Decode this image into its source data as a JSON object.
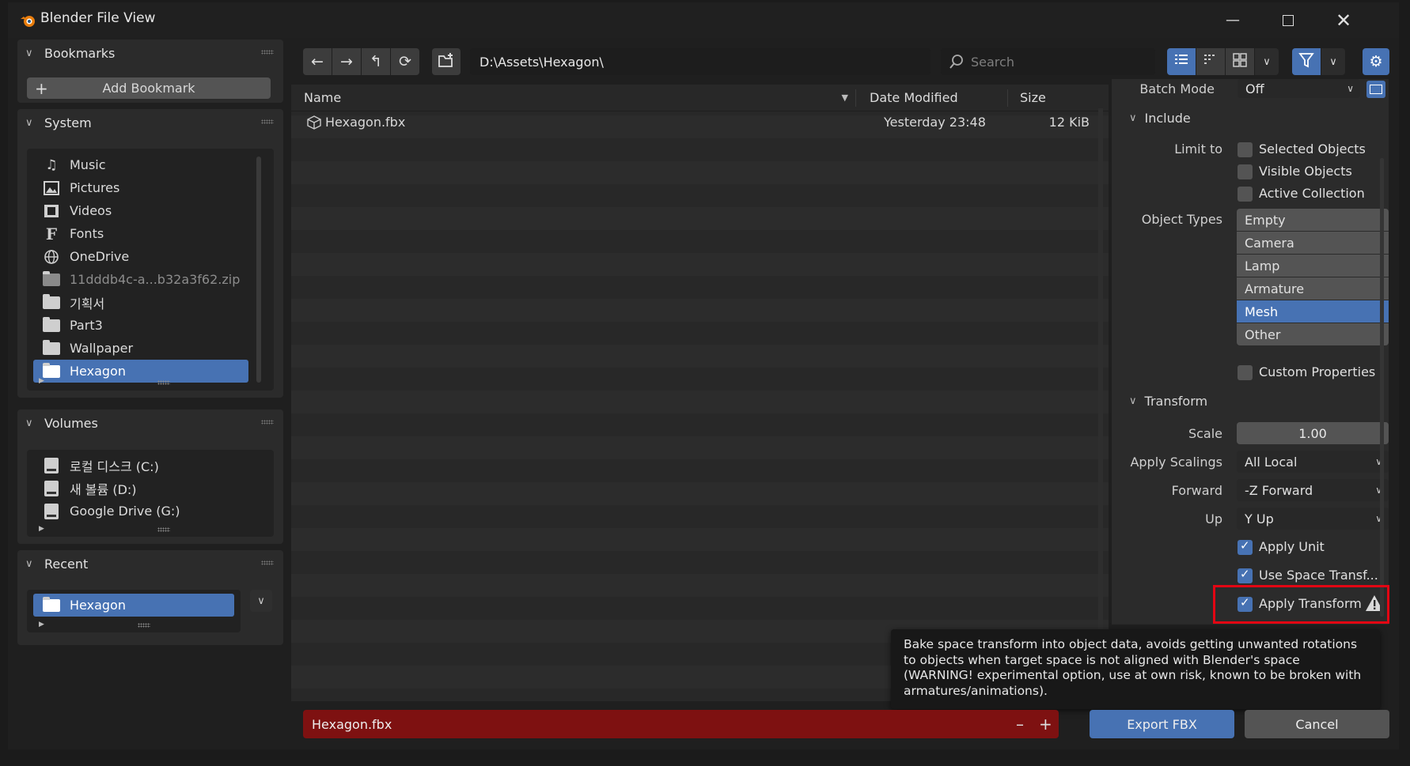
{
  "window": {
    "title": "Blender File View"
  },
  "sidebar": {
    "bookmarks": {
      "title": "Bookmarks",
      "add_label": "Add Bookmark"
    },
    "system": {
      "title": "System",
      "items": [
        {
          "label": "Music",
          "icon": "music-icon"
        },
        {
          "label": "Pictures",
          "icon": "pictures-icon"
        },
        {
          "label": "Videos",
          "icon": "videos-icon"
        },
        {
          "label": "Fonts",
          "icon": "fonts-icon"
        },
        {
          "label": "OneDrive",
          "icon": "globe-icon"
        },
        {
          "label": "11dddb4c-a...b32a3f62.zip",
          "icon": "folder-icon"
        },
        {
          "label": "기획서",
          "icon": "folder-icon"
        },
        {
          "label": "Part3",
          "icon": "folder-icon"
        },
        {
          "label": "Wallpaper",
          "icon": "folder-icon"
        },
        {
          "label": "Hexagon",
          "icon": "folder-icon"
        }
      ]
    },
    "volumes": {
      "title": "Volumes",
      "items": [
        {
          "label": "로컬 디스크 (C:)"
        },
        {
          "label": "새 볼륨 (D:)"
        },
        {
          "label": "Google Drive (G:)"
        }
      ]
    },
    "recent": {
      "title": "Recent",
      "items": [
        {
          "label": "Hexagon"
        }
      ]
    }
  },
  "toolbar": {
    "path": "D:\\Assets\\Hexagon\\",
    "search_placeholder": "Search"
  },
  "file_list": {
    "columns": {
      "name": "Name",
      "date": "Date Modified",
      "size": "Size"
    },
    "rows": [
      {
        "name": "Hexagon.fbx",
        "date": "Yesterday 23:48",
        "size": "12 KiB"
      }
    ]
  },
  "props": {
    "batch_mode_label": "Batch Mode",
    "batch_mode_value": "Off",
    "include": {
      "title": "Include",
      "limit_to_label": "Limit to",
      "limit_options": [
        {
          "label": "Selected Objects",
          "checked": false
        },
        {
          "label": "Visible Objects",
          "checked": false
        },
        {
          "label": "Active Collection",
          "checked": false
        }
      ],
      "object_types_label": "Object Types",
      "object_types": [
        {
          "label": "Empty",
          "selected": false
        },
        {
          "label": "Camera",
          "selected": false
        },
        {
          "label": "Lamp",
          "selected": false
        },
        {
          "label": "Armature",
          "selected": false
        },
        {
          "label": "Mesh",
          "selected": true
        },
        {
          "label": "Other",
          "selected": false
        }
      ],
      "custom_properties_label": "Custom Properties"
    },
    "transform": {
      "title": "Transform",
      "scale_label": "Scale",
      "scale_value": "1.00",
      "apply_scalings_label": "Apply Scalings",
      "apply_scalings_value": "All Local",
      "forward_label": "Forward",
      "forward_value": "-Z Forward",
      "up_label": "Up",
      "up_value": "Y Up",
      "apply_unit_label": "Apply Unit",
      "use_space_transform_label": "Use Space Transf...",
      "apply_transform_label": "Apply Transform"
    }
  },
  "tooltip": {
    "text": "Bake space transform into object data, avoids getting unwanted rotations to objects when target space is not aligned with Blender's space (WARNING! experimental option, use at own risk, known to be broken with armatures/animations)."
  },
  "footer": {
    "filename": "Hexagon.fbx",
    "export_label": "Export FBX",
    "cancel_label": "Cancel"
  },
  "colors": {
    "accent": "#4772b3",
    "filename_error": "#7e1111",
    "highlight": "#e30613"
  }
}
